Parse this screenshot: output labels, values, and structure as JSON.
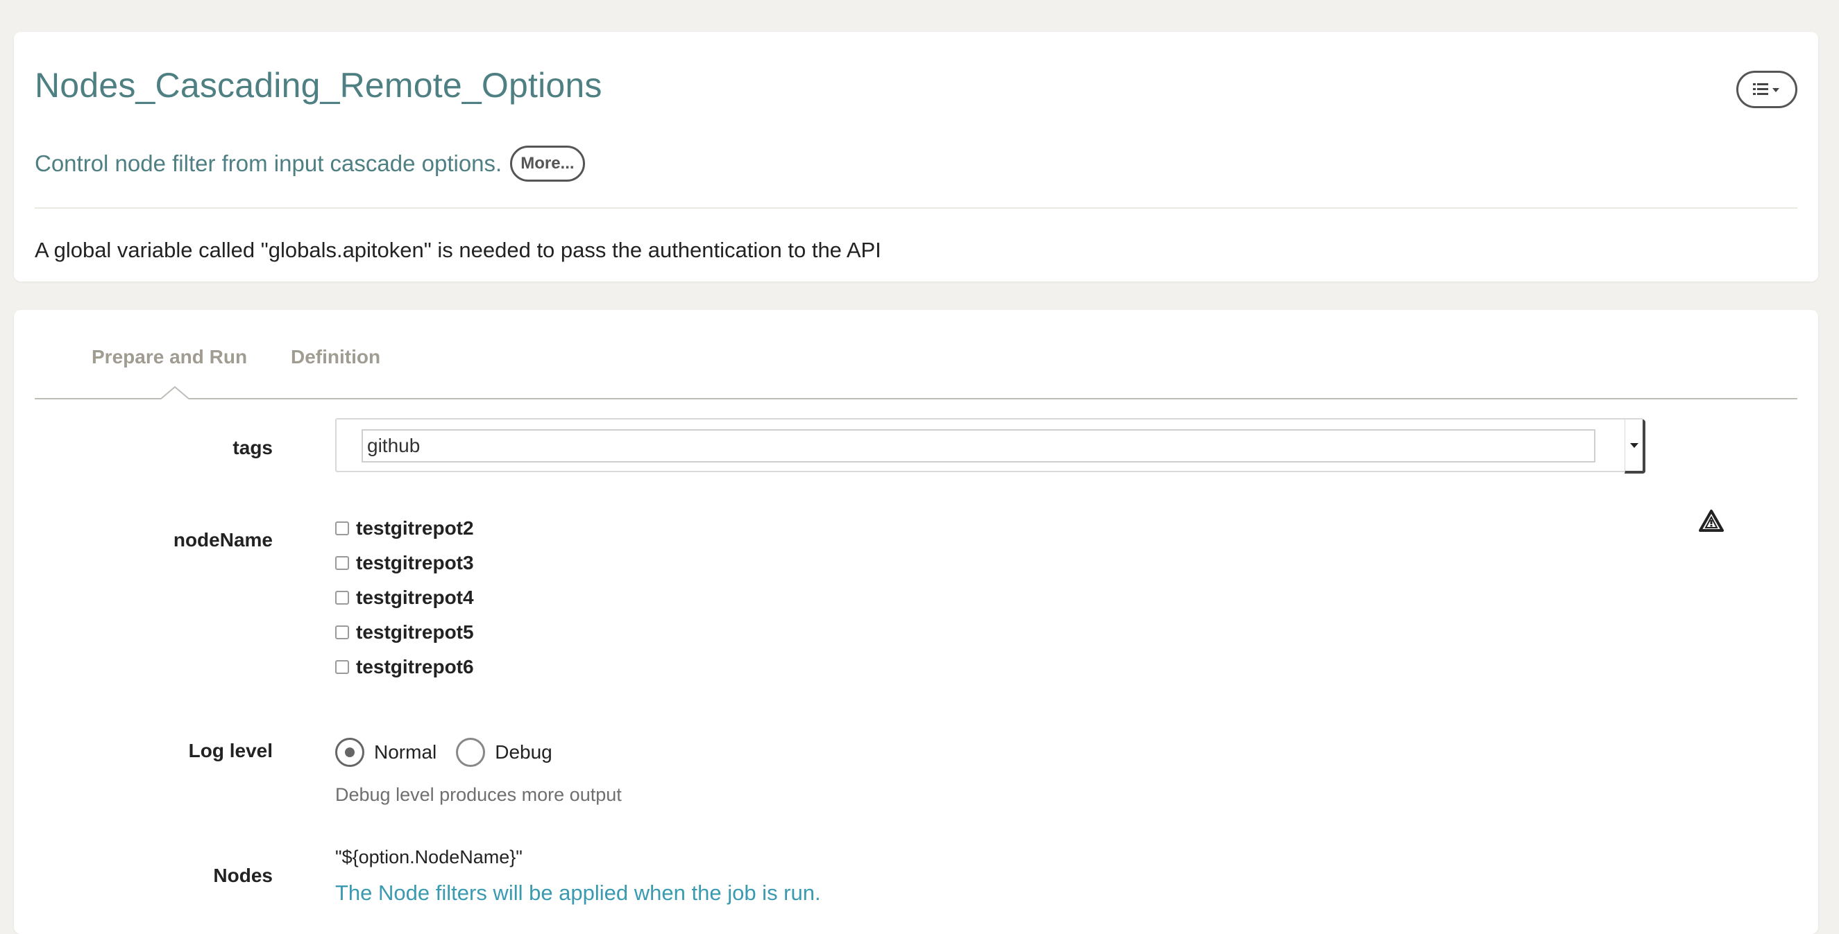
{
  "job": {
    "title": "Nodes_Cascading_Remote_Options",
    "description": "Control node filter from input cascade options.",
    "more_label": "More...",
    "global_note": "A global variable called \"globals.apitoken\" is needed to pass the authentication to the API",
    "menu_icon": "list-icon"
  },
  "tabs": [
    {
      "label": "Prepare and Run",
      "active": true
    },
    {
      "label": "Definition",
      "active": false
    }
  ],
  "options": {
    "tags": {
      "label": "tags",
      "value": "github"
    },
    "nodeName": {
      "label": "nodeName",
      "items": [
        {
          "label": "testgitrepot2",
          "checked": false
        },
        {
          "label": "testgitrepot3",
          "checked": false
        },
        {
          "label": "testgitrepot4",
          "checked": false
        },
        {
          "label": "testgitrepot5",
          "checked": false
        },
        {
          "label": "testgitrepot6",
          "checked": false
        }
      ],
      "status_icon": "warning-icon"
    },
    "log_level": {
      "label": "Log level",
      "choices": [
        {
          "label": "Normal",
          "selected": true
        },
        {
          "label": "Debug",
          "selected": false
        }
      ],
      "help": "Debug level produces more output"
    },
    "nodes": {
      "label": "Nodes",
      "filter": "\"${option.NodeName}\"",
      "note": "The Node filters will be applied when the job is run."
    }
  },
  "colors": {
    "title": "#4e7f82",
    "link": "#3a9ab0",
    "tab_inactive": "#a09c92",
    "background": "#f2f1ee"
  }
}
